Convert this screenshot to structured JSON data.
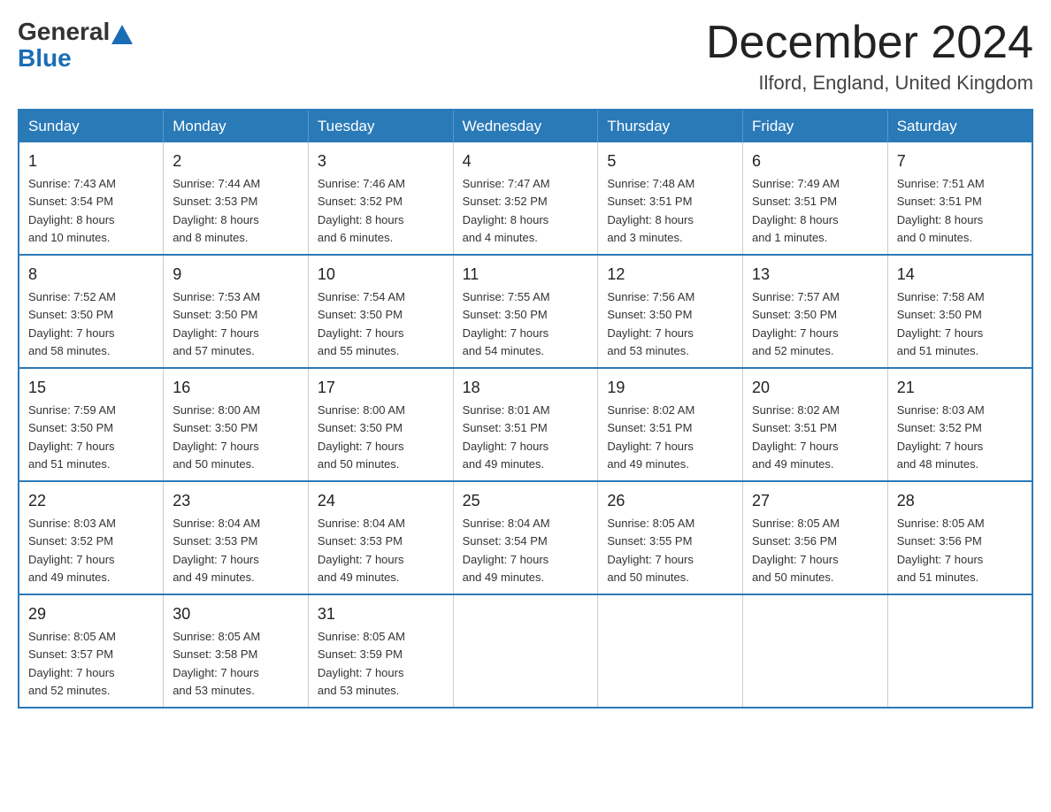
{
  "logo": {
    "general": "General",
    "blue": "Blue"
  },
  "title": {
    "month_year": "December 2024",
    "location": "Ilford, England, United Kingdom"
  },
  "weekdays": [
    "Sunday",
    "Monday",
    "Tuesday",
    "Wednesday",
    "Thursday",
    "Friday",
    "Saturday"
  ],
  "weeks": [
    [
      {
        "day": "1",
        "sunrise": "7:43 AM",
        "sunset": "3:54 PM",
        "daylight": "8 hours and 10 minutes."
      },
      {
        "day": "2",
        "sunrise": "7:44 AM",
        "sunset": "3:53 PM",
        "daylight": "8 hours and 8 minutes."
      },
      {
        "day": "3",
        "sunrise": "7:46 AM",
        "sunset": "3:52 PM",
        "daylight": "8 hours and 6 minutes."
      },
      {
        "day": "4",
        "sunrise": "7:47 AM",
        "sunset": "3:52 PM",
        "daylight": "8 hours and 4 minutes."
      },
      {
        "day": "5",
        "sunrise": "7:48 AM",
        "sunset": "3:51 PM",
        "daylight": "8 hours and 3 minutes."
      },
      {
        "day": "6",
        "sunrise": "7:49 AM",
        "sunset": "3:51 PM",
        "daylight": "8 hours and 1 minute."
      },
      {
        "day": "7",
        "sunrise": "7:51 AM",
        "sunset": "3:51 PM",
        "daylight": "8 hours and 0 minutes."
      }
    ],
    [
      {
        "day": "8",
        "sunrise": "7:52 AM",
        "sunset": "3:50 PM",
        "daylight": "7 hours and 58 minutes."
      },
      {
        "day": "9",
        "sunrise": "7:53 AM",
        "sunset": "3:50 PM",
        "daylight": "7 hours and 57 minutes."
      },
      {
        "day": "10",
        "sunrise": "7:54 AM",
        "sunset": "3:50 PM",
        "daylight": "7 hours and 55 minutes."
      },
      {
        "day": "11",
        "sunrise": "7:55 AM",
        "sunset": "3:50 PM",
        "daylight": "7 hours and 54 minutes."
      },
      {
        "day": "12",
        "sunrise": "7:56 AM",
        "sunset": "3:50 PM",
        "daylight": "7 hours and 53 minutes."
      },
      {
        "day": "13",
        "sunrise": "7:57 AM",
        "sunset": "3:50 PM",
        "daylight": "7 hours and 52 minutes."
      },
      {
        "day": "14",
        "sunrise": "7:58 AM",
        "sunset": "3:50 PM",
        "daylight": "7 hours and 51 minutes."
      }
    ],
    [
      {
        "day": "15",
        "sunrise": "7:59 AM",
        "sunset": "3:50 PM",
        "daylight": "7 hours and 51 minutes."
      },
      {
        "day": "16",
        "sunrise": "8:00 AM",
        "sunset": "3:50 PM",
        "daylight": "7 hours and 50 minutes."
      },
      {
        "day": "17",
        "sunrise": "8:00 AM",
        "sunset": "3:50 PM",
        "daylight": "7 hours and 50 minutes."
      },
      {
        "day": "18",
        "sunrise": "8:01 AM",
        "sunset": "3:51 PM",
        "daylight": "7 hours and 49 minutes."
      },
      {
        "day": "19",
        "sunrise": "8:02 AM",
        "sunset": "3:51 PM",
        "daylight": "7 hours and 49 minutes."
      },
      {
        "day": "20",
        "sunrise": "8:02 AM",
        "sunset": "3:51 PM",
        "daylight": "7 hours and 49 minutes."
      },
      {
        "day": "21",
        "sunrise": "8:03 AM",
        "sunset": "3:52 PM",
        "daylight": "7 hours and 48 minutes."
      }
    ],
    [
      {
        "day": "22",
        "sunrise": "8:03 AM",
        "sunset": "3:52 PM",
        "daylight": "7 hours and 49 minutes."
      },
      {
        "day": "23",
        "sunrise": "8:04 AM",
        "sunset": "3:53 PM",
        "daylight": "7 hours and 49 minutes."
      },
      {
        "day": "24",
        "sunrise": "8:04 AM",
        "sunset": "3:53 PM",
        "daylight": "7 hours and 49 minutes."
      },
      {
        "day": "25",
        "sunrise": "8:04 AM",
        "sunset": "3:54 PM",
        "daylight": "7 hours and 49 minutes."
      },
      {
        "day": "26",
        "sunrise": "8:05 AM",
        "sunset": "3:55 PM",
        "daylight": "7 hours and 50 minutes."
      },
      {
        "day": "27",
        "sunrise": "8:05 AM",
        "sunset": "3:56 PM",
        "daylight": "7 hours and 50 minutes."
      },
      {
        "day": "28",
        "sunrise": "8:05 AM",
        "sunset": "3:56 PM",
        "daylight": "7 hours and 51 minutes."
      }
    ],
    [
      {
        "day": "29",
        "sunrise": "8:05 AM",
        "sunset": "3:57 PM",
        "daylight": "7 hours and 52 minutes."
      },
      {
        "day": "30",
        "sunrise": "8:05 AM",
        "sunset": "3:58 PM",
        "daylight": "7 hours and 53 minutes."
      },
      {
        "day": "31",
        "sunrise": "8:05 AM",
        "sunset": "3:59 PM",
        "daylight": "7 hours and 53 minutes."
      },
      null,
      null,
      null,
      null
    ]
  ],
  "labels": {
    "sunrise": "Sunrise:",
    "sunset": "Sunset:",
    "daylight": "Daylight:"
  }
}
